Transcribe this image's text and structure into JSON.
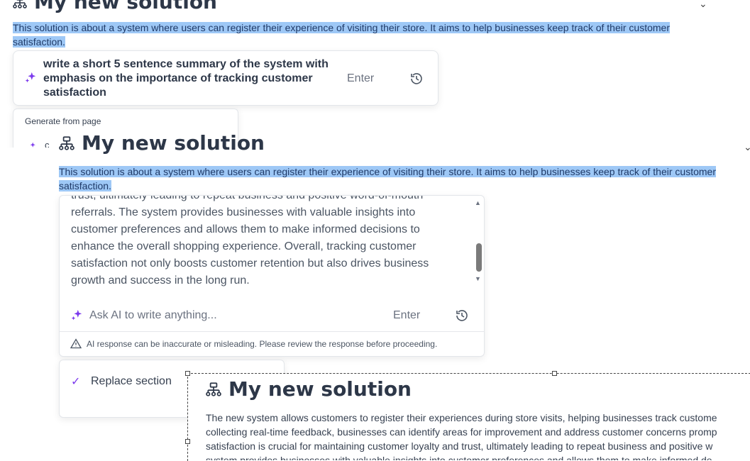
{
  "layer1": {
    "title": "My new solution",
    "description": "This solution is about a system where users can register their experience of visiting their store. It aims to help businesses keep track of their customer satisfaction.",
    "prompt_text": "write a short 5 sentence summary of the system with emphasis on the importance of tracking customer satisfaction",
    "enter_label": "Enter",
    "generate_from_page": "Generate from page",
    "partial_menu_text": "c"
  },
  "layer2": {
    "title": "My new solution",
    "description": "This solution is about a system where users can register their experience of visiting their store. It aims to help businesses keep track of their customer satisfaction.",
    "response_lines": [
      "trust, ultimately leading to repeat business and positive word-of-mouth",
      "referrals. The system provides businesses with valuable insights into",
      "customer preferences and allows them to make informed decisions to",
      "enhance the overall shopping experience. Overall, tracking customer",
      "satisfaction not only boosts customer retention but also drives business",
      "growth and success in the long run."
    ],
    "ask_placeholder": "Ask AI to write anything...",
    "enter_label": "Enter",
    "disclaimer": "AI response can be inaccurate or misleading. Please review the response before proceeding.",
    "replace_section": "Replace section"
  },
  "layer3": {
    "title": "My new solution",
    "body_lines": [
      "The new system allows customers to register their experiences during store visits, helping businesses track custome",
      "collecting real-time feedback, businesses can identify areas for improvement and address customer concerns promp",
      "satisfaction is crucial for maintaining customer loyalty and trust, ultimately leading to repeat business and positive w",
      "system provides businesses with valuable insights into customer preferences and allows them to make informed de"
    ]
  },
  "colors": {
    "accent": "#7c3aed",
    "highlight": "#9ec8f6",
    "text": "#2d3748"
  },
  "icons": [
    "hierarchy-icon",
    "sparkle-icon",
    "history-icon",
    "chevron-down-icon",
    "warning-icon",
    "check-icon",
    "scroll-up-icon",
    "scroll-down-icon"
  ]
}
